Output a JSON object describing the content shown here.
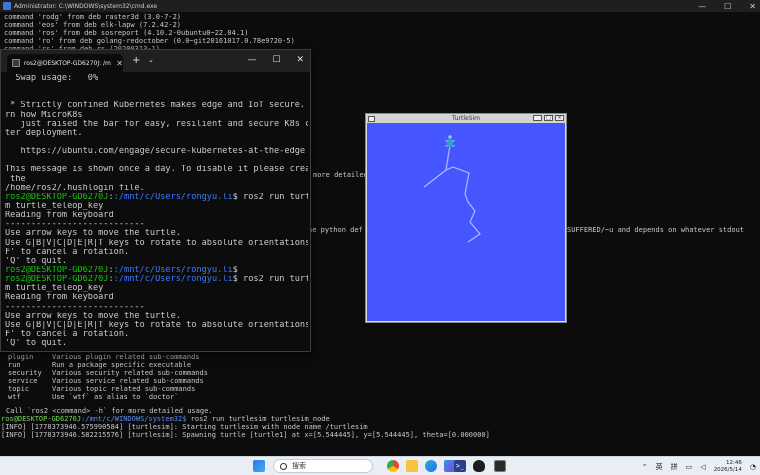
{
  "bg_console": {
    "title": "Administrator: C:\\WINDOWS\\system32\\cmd.exe",
    "top_lines": [
      "command 'rodg' from deb raster3d (3.0-7-2)",
      "command 'eos' from deb elk-lapw (7.2.42-2)",
      "command 'ros' from deb sosreport (4.10.2-0ubuntu0~22.04.1)",
      "command 'ro' from deb golang-redoctober (0.0~git20161017.0.78e9720-5)",
      "command 'rs' from deb rs (20200313-1)"
    ],
    "right_fragments": {
      "more_detailed": "more detailed",
      "python_default": "he python def",
      "suffered": "SUFFERED/~u and depends on whatever stdout"
    },
    "commands": [
      {
        "name": "plugin",
        "desc": "Various plugin related sub-commands"
      },
      {
        "name": "run",
        "desc": "Run a package specific executable"
      },
      {
        "name": "security",
        "desc": "Various security related sub-commands"
      },
      {
        "name": "service",
        "desc": "Various service related sub-commands"
      },
      {
        "name": "topic",
        "desc": "Various topic related sub-commands"
      },
      {
        "name": "wtf",
        "desc": "Use `wtf` as alias to `doctor`"
      }
    ],
    "call_hint": "Call `ros2 <command> -h` for more detailed usage.",
    "prompt_user": "ros@DESKTOP-GD6270J",
    "prompt_path": ":/mnt/c/WINDOWS/system32$",
    "prompt_cmd": " ros2 run turtlesim turtlesim_node",
    "info_1": "[INFO] [1778373946.575990584] [turtlesim]: Starting turtlesim with node name /turtlesim",
    "info_2": "[INFO] [1778373946.582215576] [turtlesim]: Spawning turtle [turtle1] at x=[5.544445], y=[5.544445], theta=[0.000000]"
  },
  "terminal": {
    "tab_title": "ros2@DESKTOP-GD6270J: /m",
    "new_tab": "+",
    "dropdown": "⌄",
    "controls": {
      "minimize": "—",
      "maximize": "☐",
      "close": "✕"
    },
    "lines": [
      "  Swap usage:   0%",
      "",
      "",
      " * Strictly confined Kubernetes makes edge and IoT secure. Lea",
      "rn how MicroK8s",
      "   just raised the bar for easy, resilient and secure K8s clus",
      "ter deployment.",
      "",
      "   https://ubuntu.com/engage/secure-kubernetes-at-the-edge",
      "",
      "This message is shown once a day. To disable it please create",
      " the",
      "/home/ros2/.hushlogin file."
    ],
    "prompt_user": "ros2@DESKTOP-GD6270J",
    "prompt_path": ":/mnt/c/Users/rongyu.li",
    "cmd_1_a": "$ ros2 run turtlesi",
    "cmd_1_b": "m turtle_teleop_key",
    "reading": "Reading from keyboard",
    "dashes": "---------------------------",
    "use_arrows": "Use arrow keys to move the turtle.",
    "use_g_a": "Use G|B|V|C|D|E|R|T keys to rotate to absolute orientations. '",
    "use_g_b": "F' to cancel a rotation.",
    "quit": "'Q' to quit.",
    "empty_prompt_suffix": "$",
    "cmd_2_a": "$ ros2 run turtlesi",
    "cmd_2_b": "m turtle_teleop_key"
  },
  "turtlesim": {
    "title": "TurtleSim",
    "background": "#4556ff",
    "pen_color": "#b3b8ff"
  },
  "taskbar": {
    "search_placeholder": "搜索",
    "ime_lang": "英",
    "ime_mode": "拼",
    "time": "12:46",
    "date": "2026/5/14"
  }
}
